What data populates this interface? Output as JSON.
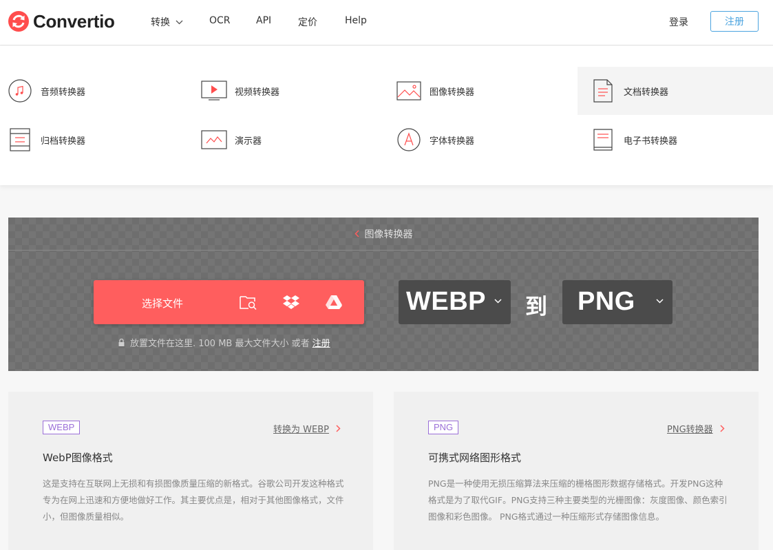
{
  "brand": {
    "name": "Convertio",
    "accent": "#ff5e5e",
    "link_color": "#4aa3df",
    "badge_color": "#9b6fd8"
  },
  "header": {
    "nav": [
      {
        "label": "转换",
        "has_dropdown": true
      },
      {
        "label": "OCR"
      },
      {
        "label": "API"
      },
      {
        "label": "定价"
      },
      {
        "label": "Help"
      }
    ],
    "login": "登录",
    "signup": "注册"
  },
  "categories": [
    {
      "label": "音频转换器",
      "icon": "music-note-icon"
    },
    {
      "label": "视频转换器",
      "icon": "video-play-icon"
    },
    {
      "label": "图像转换器",
      "icon": "image-icon"
    },
    {
      "label": "文档转换器",
      "icon": "document-icon",
      "active": true
    },
    {
      "label": "归档转换器",
      "icon": "archive-icon"
    },
    {
      "label": "演示器",
      "icon": "presentation-icon"
    },
    {
      "label": "字体转换器",
      "icon": "font-icon"
    },
    {
      "label": "电子书转换器",
      "icon": "ebook-icon"
    }
  ],
  "converter": {
    "breadcrumb": "图像转换器",
    "choose_files": "选择文件",
    "sources": [
      "folder-search-icon",
      "dropbox-icon",
      "google-drive-icon"
    ],
    "drop_note": "放置文件在这里. 100 MB 最大文件大小 或者",
    "drop_note_link": "注册",
    "from_format": "WEBP",
    "to_label": "到",
    "to_format": "PNG"
  },
  "cards": [
    {
      "badge": "WEBP",
      "link": "转换为 WEBP",
      "title": "WebP图像格式",
      "description": "这是支持在互联网上无损和有损图像质量压缩的新格式。谷歌公司开发这种格式专为在网上迅速和方便地做好工作。其主要优点是，相对于其他图像格式，文件小，但图像质量相似。"
    },
    {
      "badge": "PNG",
      "link": "PNG转换器",
      "title": "可携式网络图形格式",
      "description": "PNG是一种使用无损压缩算法来压缩的栅格图形数据存储格式。开发PNG这种格式是为了取代GIF。PNG支持三种主要类型的光栅图像：灰度图像、颜色索引图像和彩色图像。 PNG格式通过一种压缩形式存储图像信息。"
    }
  ]
}
